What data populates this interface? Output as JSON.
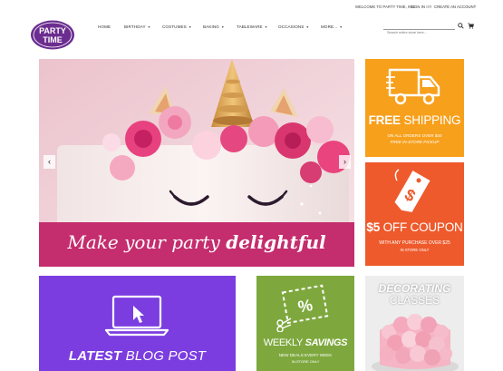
{
  "topbar": {
    "welcome": "WELCOME TO PARTY TIME, INC.",
    "sign_in": "SIGN IN",
    "or": "OR",
    "create_account": "CREATE AN ACCOUNT"
  },
  "logo": {
    "line1": "PARTY",
    "line2": "TIME"
  },
  "nav": {
    "items": [
      {
        "label": "HOME"
      },
      {
        "label": "BIRTHDAY"
      },
      {
        "label": "COSTUMES"
      },
      {
        "label": "BAKING"
      },
      {
        "label": "TABLEWARE"
      },
      {
        "label": "OCCASIONS"
      },
      {
        "label": "MORE..."
      }
    ]
  },
  "search": {
    "placeholder": "Search entire store here..."
  },
  "hero": {
    "tagline_light": "Make your party",
    "tagline_bold": "delightful",
    "prev_label": "‹",
    "next_label": "›"
  },
  "promos": {
    "shipping": {
      "title_bold": "FREE",
      "title_light": "SHIPPING",
      "sub1": "ON ALL ORDERS OVER $40",
      "sub2": "FREE IN-STORE PICKUP",
      "icon": "delivery-truck-icon"
    },
    "coupon": {
      "title_bold": "$5",
      "title_light": "OFF COUPON",
      "sub1": "WITH ANY PURCHASE OVER $25",
      "sub2": "IN STORE ONLY",
      "icon": "price-tag-icon",
      "tag_text": "$"
    },
    "blog": {
      "title_bold": "LATEST",
      "title_light": "BLOG POST",
      "icon": "laptop-cursor-icon"
    },
    "savings": {
      "title_light": "WEEKLY",
      "title_bold": "SAVINGS",
      "sub1": "NEW DEALS EVERY WEEK",
      "sub2": "IN-STORE ONLY",
      "icon": "coupon-scissors-icon",
      "coupon_text": "%"
    },
    "classes": {
      "title1": "DECORATING",
      "title2": "CLASSES"
    }
  },
  "colors": {
    "logo_purple": "#6b2d8f",
    "hero_band": "#c42d6e",
    "shipping": "#f7a01c",
    "coupon": "#ee5a2c",
    "blog": "#7b3de0",
    "savings": "#7ea83e"
  }
}
